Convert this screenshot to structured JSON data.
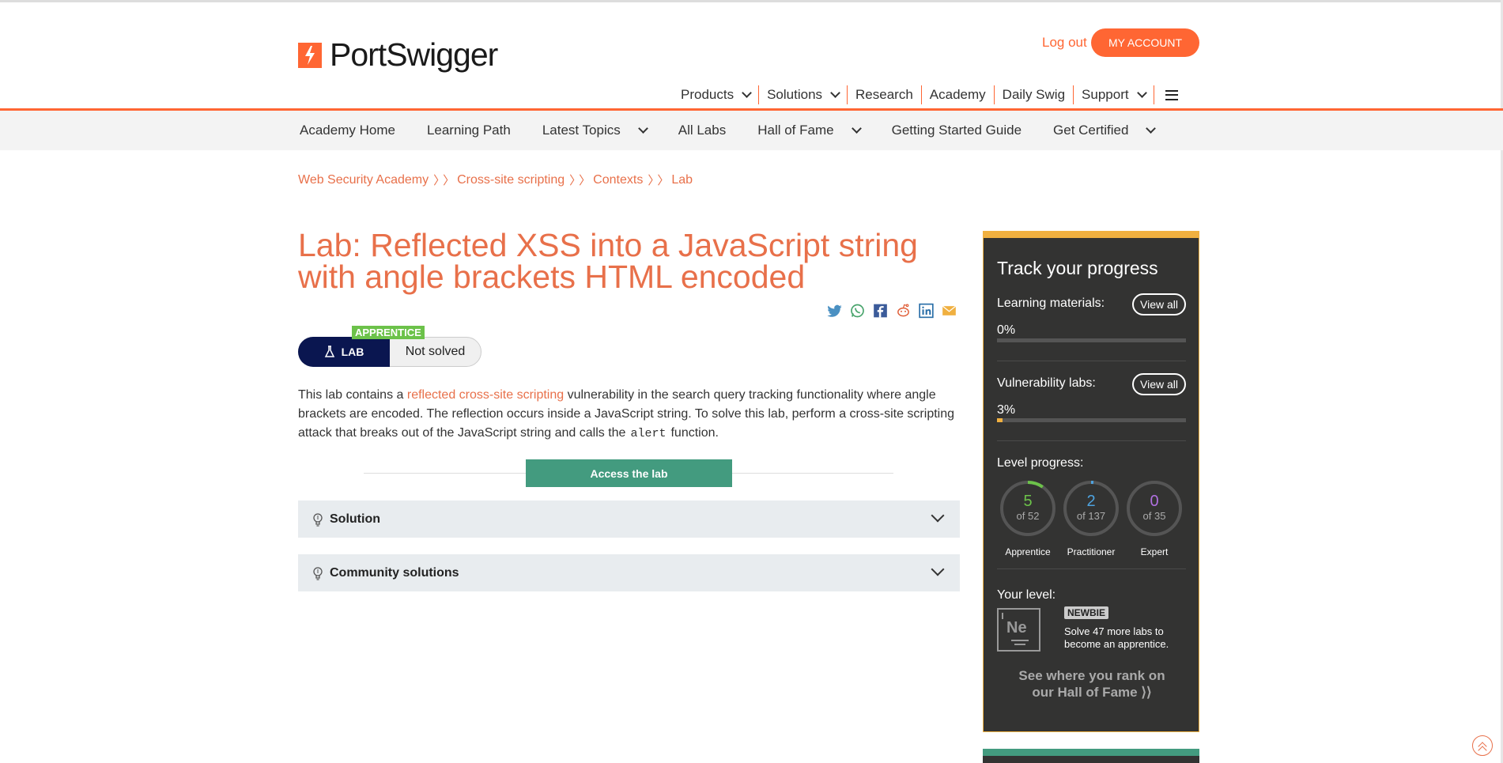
{
  "header": {
    "logo_text": "PortSwigger",
    "logout_label": "Log out",
    "account_label": "MY ACCOUNT",
    "nav": [
      {
        "label": "Products",
        "dropdown": true
      },
      {
        "label": "Solutions",
        "dropdown": true
      },
      {
        "label": "Research",
        "dropdown": false
      },
      {
        "label": "Academy",
        "dropdown": false
      },
      {
        "label": "Daily Swig",
        "dropdown": false
      },
      {
        "label": "Support",
        "dropdown": true
      }
    ]
  },
  "subnav": [
    {
      "label": "Academy Home",
      "dropdown": false
    },
    {
      "label": "Learning Path",
      "dropdown": false
    },
    {
      "label": "Latest Topics",
      "dropdown": true
    },
    {
      "label": "All Labs",
      "dropdown": false
    },
    {
      "label": "Hall of Fame",
      "dropdown": true
    },
    {
      "label": "Getting Started Guide",
      "dropdown": false
    },
    {
      "label": "Get Certified",
      "dropdown": true
    }
  ],
  "breadcrumb": [
    "Web Security Academy",
    "Cross-site scripting",
    "Contexts",
    "Lab"
  ],
  "lab": {
    "title": "Lab: Reflected XSS into a JavaScript string with angle brackets HTML encoded",
    "level": "APPRENTICE",
    "badge_label": "LAB",
    "status": "Not solved",
    "desc_1": "This lab contains a ",
    "desc_link": "reflected cross-site scripting",
    "desc_2": " vulnerability in the search query tracking functionality where angle brackets are encoded. The reflection occurs inside a JavaScript string. To solve this lab, perform a cross-site scripting attack that breaks out of the JavaScript string and calls the",
    "desc_code": "alert",
    "desc_3": "function.",
    "access_label": "Access the lab",
    "accordions": [
      "Solution",
      "Community solutions"
    ]
  },
  "share_icons": [
    "twitter-icon",
    "whatsapp-icon",
    "facebook-icon",
    "reddit-icon",
    "linkedin-icon",
    "email-icon"
  ],
  "progress": {
    "title": "Track your progress",
    "learning_label": "Learning materials:",
    "learning_pct": "0%",
    "learning_value": 0,
    "view_all": "View all",
    "vuln_label": "Vulnerability labs:",
    "vuln_pct": "3%",
    "vuln_value": 3,
    "level_label": "Level progress:",
    "rings": [
      {
        "value": "5",
        "of": "of 52",
        "label": "Apprentice",
        "color": "#6cc24a",
        "solved": 5,
        "total": 52
      },
      {
        "value": "2",
        "of": "of 137",
        "label": "Practitioner",
        "color": "#4ea3e0",
        "solved": 2,
        "total": 137
      },
      {
        "value": "0",
        "of": "of 35",
        "label": "Expert",
        "color": "#b070e0",
        "solved": 0,
        "total": 35
      }
    ],
    "your_level_label": "Your level:",
    "element_symbol": "Ne",
    "level_name": "NEWBIE",
    "solve_more": "Solve 47 more labs to become an apprentice.",
    "rank_text": "See where you rank on our Hall of Fame"
  },
  "colors": {
    "accent": "#ff6633",
    "link": "#e8704a",
    "lab_navy": "#0a1650",
    "access_green": "#439b7f",
    "apprentice_green": "#6cc24a",
    "sidebar_bg": "#333332",
    "sidebar_border": "#f0b040"
  }
}
